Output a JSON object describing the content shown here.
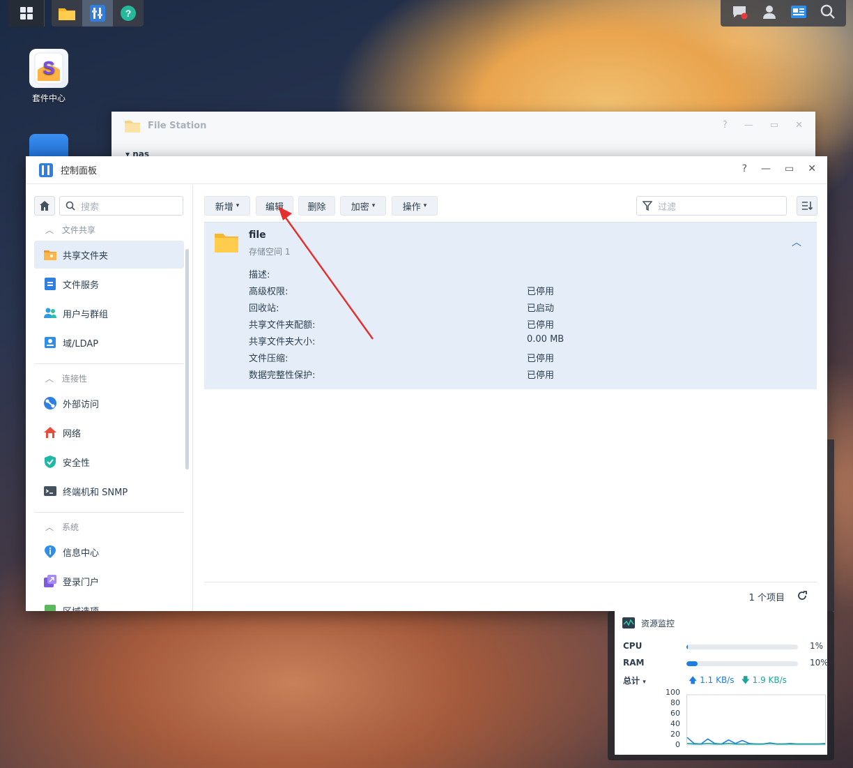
{
  "desktop": {
    "package_center_label": "套件中心"
  },
  "file_station": {
    "title": "File Station",
    "tree_root": "nas"
  },
  "control_panel": {
    "title": "控制面板",
    "search_placeholder": "搜索",
    "sections": [
      {
        "title": "文件共享",
        "items": [
          "共享文件夹",
          "文件服务",
          "用户与群组",
          "域/LDAP"
        ]
      },
      {
        "title": "连接性",
        "items": [
          "外部访问",
          "网络",
          "安全性",
          "终端机和 SNMP"
        ]
      },
      {
        "title": "系统",
        "items": [
          "信息中心",
          "登录门户",
          "区域选项"
        ]
      }
    ],
    "toolbar": {
      "create": "新增",
      "edit": "编辑",
      "delete": "删除",
      "encrypt": "加密",
      "action": "操作",
      "filter_placeholder": "过滤"
    },
    "shared_folder": {
      "name": "file",
      "location": "存储空间 1",
      "properties": [
        {
          "label": "描述:",
          "value": ""
        },
        {
          "label": "高级权限:",
          "value": "已停用"
        },
        {
          "label": "回收站:",
          "value": "已启动"
        },
        {
          "label": "共享文件夹配额:",
          "value": "已停用"
        },
        {
          "label": "共享文件夹大小:",
          "value": "0.00 MB"
        },
        {
          "label": "文件压缩:",
          "value": "已停用"
        },
        {
          "label": "数据完整性保护:",
          "value": "已停用"
        }
      ]
    },
    "footer": {
      "count": "1 个项目"
    }
  },
  "resource_monitor": {
    "title": "资源监控",
    "cpu_label": "CPU",
    "cpu_pct": "1%",
    "cpu_value": 1,
    "ram_label": "RAM",
    "ram_pct": "10%",
    "ram_value": 10,
    "total_label": "总计",
    "upload": "1.1 KB/s",
    "download": "1.9 KB/s",
    "y_ticks": [
      "100",
      "80",
      "60",
      "40",
      "20",
      "0"
    ],
    "colors": {
      "upload": "#1f7de0",
      "download": "#1aa59a"
    }
  },
  "chart_data": {
    "type": "line",
    "ylim": [
      0,
      100
    ],
    "series": [
      {
        "name": "upload",
        "values": [
          15,
          3,
          2,
          12,
          3,
          2,
          10,
          3,
          9,
          3,
          2,
          2,
          4,
          2,
          2,
          3,
          2,
          2,
          2,
          2,
          3
        ]
      },
      {
        "name": "download",
        "values": [
          3,
          2,
          2,
          3,
          2,
          2,
          3,
          2,
          2,
          2,
          2,
          2,
          3,
          2,
          2,
          2,
          2,
          2,
          2,
          2,
          2
        ]
      }
    ]
  }
}
